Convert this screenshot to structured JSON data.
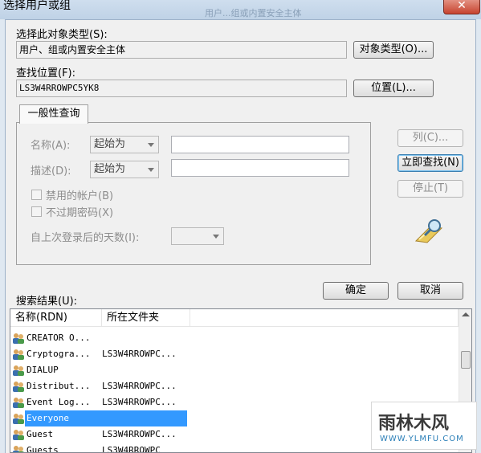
{
  "window": {
    "title": "选择用户或组",
    "background_window_text": "用户...组或内置安全主体"
  },
  "object_types": {
    "label": "选择此对象类型(S):",
    "value": "用户、组或内置安全主体",
    "button": "对象类型(O)..."
  },
  "location": {
    "label": "查找位置(F):",
    "value": "LS3W4RROWPC5YK8",
    "button": "位置(L)..."
  },
  "common_queries": {
    "tab": "一般性查询",
    "name_label": "名称(A):",
    "name_combo": "起始为",
    "desc_label": "描述(D):",
    "desc_combo": "起始为",
    "disabled_accounts": "禁用的帐户(B)",
    "non_expiring_pw": "不过期密码(X)",
    "days_label": "自上次登录后的天数(I):"
  },
  "side_buttons": {
    "columns": "列(C)...",
    "find_now": "立即查找(N)",
    "stop": "停止(T)"
  },
  "dialog_buttons": {
    "ok": "确定",
    "cancel": "取消"
  },
  "results": {
    "label": "搜索结果(U):",
    "columns": [
      "名称(RDN)",
      "所在文件夹"
    ],
    "rows": [
      {
        "name": "CREATOR O...",
        "folder": ""
      },
      {
        "name": "Cryptogra...",
        "folder": "LS3W4RROWPC..."
      },
      {
        "name": "DIALUP",
        "folder": ""
      },
      {
        "name": "Distribut...",
        "folder": "LS3W4RROWPC..."
      },
      {
        "name": "Event Log...",
        "folder": "LS3W4RROWPC..."
      },
      {
        "name": "Everyone",
        "folder": ""
      },
      {
        "name": "Guest",
        "folder": "LS3W4RROWPC..."
      },
      {
        "name": "Guests",
        "folder": "LS3W4RROWPC"
      }
    ],
    "selected_row": "Everyone"
  },
  "watermark": {
    "brand": "雨林木风",
    "url": "WWW.YLMFU.COM"
  },
  "colors": {
    "selection": "#3399ff",
    "title_bar": "#c4d5e9",
    "close_button": "#c7432f"
  }
}
